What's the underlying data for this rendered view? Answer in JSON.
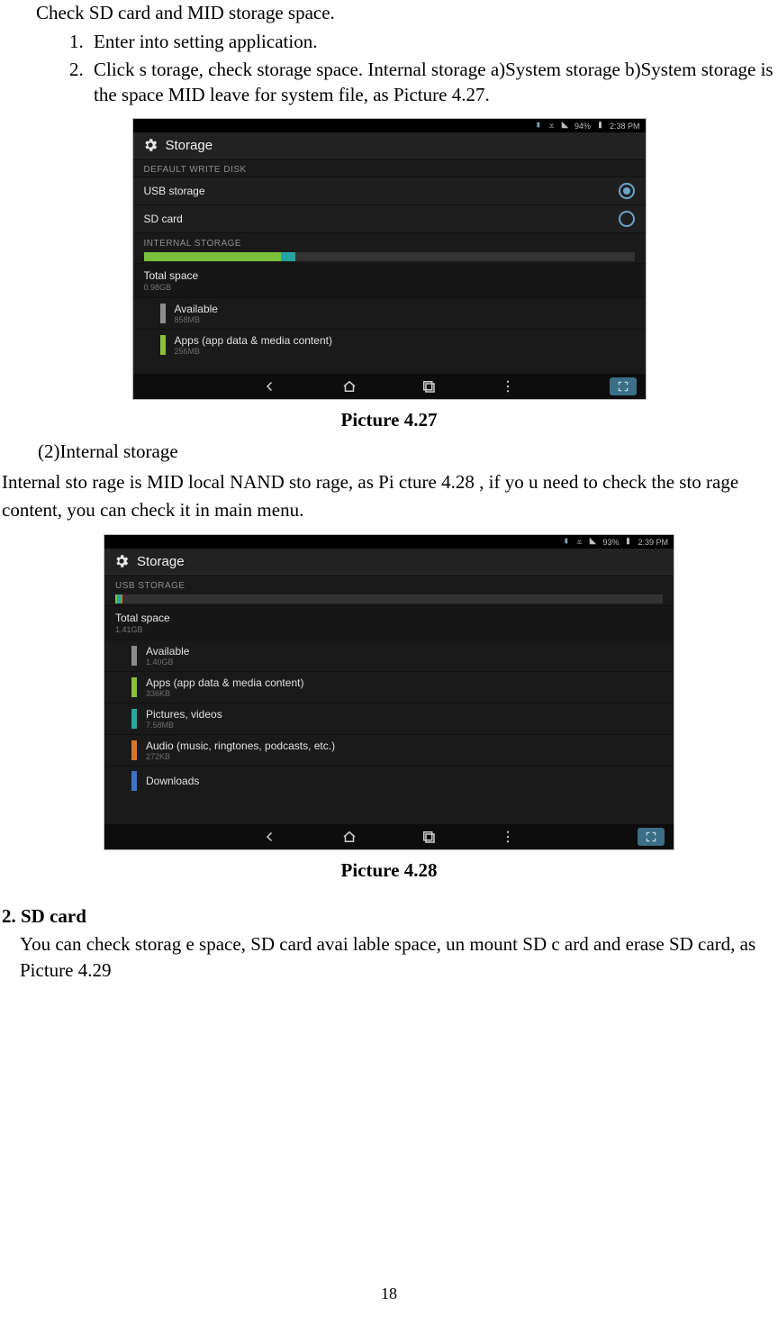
{
  "doc": {
    "intro": "Check SD card and MID storage space.",
    "steps": [
      "Enter into setting application.",
      "Click s  torage, check   storage space.      Internal storage a)System    storage b)System storage is the space MID leave for system file, as Picture 4.27."
    ],
    "caption1": "Picture 4.27",
    "sub2_label": "(2)Internal storage",
    "para2": "Internal sto rage  is MID local NAND sto  rage, as Pi cture 4.28 ,  if yo u  need  to check the sto  rage content, you can check it in main menu.",
    "caption2": "Picture 4.28",
    "sec2_head": "2.    SD card",
    "sec2_body": "You can check storag e space, SD card avai lable space, un mount SD c ard and erase SD card, as Picture 4.29",
    "page_number": "18"
  },
  "shot1": {
    "status_time": "2:38 PM",
    "status_pct": "94%",
    "title": "Storage",
    "section_default": "DEFAULT WRITE DISK",
    "usb": "USB storage",
    "sd": "SD card",
    "section_internal": "INTERNAL STORAGE",
    "total_label": "Total space",
    "total_value": "0.98GB",
    "avail_label": "Available",
    "avail_value": "858MB",
    "apps_label": "Apps (app data & media content)",
    "apps_value": "256MB",
    "bar": [
      {
        "color": "#7bbf3a",
        "pct": 28
      },
      {
        "color": "#23a6a3",
        "pct": 3
      }
    ]
  },
  "shot2": {
    "status_time": "2:39 PM",
    "status_pct": "93%",
    "title": "Storage",
    "section_usb": "USB STORAGE",
    "total_label": "Total space",
    "total_value": "1.41GB",
    "items": [
      {
        "color": "#8d8d8d",
        "label": "Available",
        "value": "1.40GB"
      },
      {
        "color": "#8bbf3a",
        "label": "Apps (app data & media content)",
        "value": "336KB"
      },
      {
        "color": "#24a8a2",
        "label": "Pictures, videos",
        "value": "7.58MB"
      },
      {
        "color": "#d6762a",
        "label": "Audio (music, ringtones, podcasts, etc.)",
        "value": "272KB"
      },
      {
        "color": "#3b74c3",
        "label": "Downloads",
        "value": ""
      }
    ],
    "bar": [
      {
        "color": "#8bbf3a",
        "pct": 0.4
      },
      {
        "color": "#24a8a2",
        "pct": 0.6
      },
      {
        "color": "#d6762a",
        "pct": 0.3
      }
    ]
  }
}
